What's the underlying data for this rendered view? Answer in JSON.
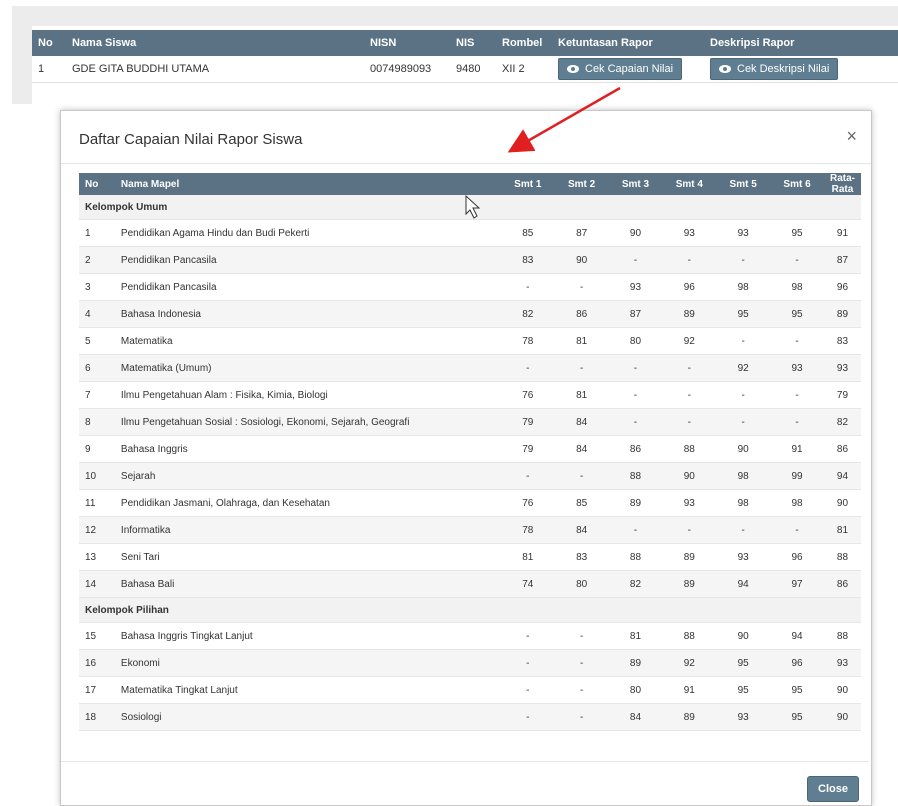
{
  "student_table": {
    "headers": [
      "No",
      "Nama Siswa",
      "NISN",
      "NIS",
      "Rombel",
      "Ketuntasan Rapor",
      "Deskripsi Rapor"
    ],
    "row": {
      "no": "1",
      "name": "GDE GITA BUDDHI UTAMA",
      "nisn": "0074989093",
      "nis": "9480",
      "rombel": "XII 2",
      "btn_capaian": "Cek Capaian Nilai",
      "btn_deskripsi": "Cek Deskripsi Nilai"
    }
  },
  "modal": {
    "title": "Daftar Capaian Nilai Rapor Siswa",
    "close_symbol": "×",
    "headers": {
      "no": "No",
      "mapel": "Nama Mapel",
      "smt1": "Smt 1",
      "smt2": "Smt 2",
      "smt3": "Smt 3",
      "smt4": "Smt 4",
      "smt5": "Smt 5",
      "smt6": "Smt 6",
      "avg": "Rata-Rata"
    },
    "groups": [
      {
        "label": "Kelompok Umum",
        "rows": [
          {
            "no": "1",
            "mapel": "Pendidikan Agama Hindu dan Budi Pekerti",
            "smt": [
              "85",
              "87",
              "90",
              "93",
              "93",
              "95"
            ],
            "avg": "91"
          },
          {
            "no": "2",
            "mapel": "Pendidikan Pancasila",
            "smt": [
              "83",
              "90",
              "-",
              "-",
              "-",
              "-"
            ],
            "avg": "87"
          },
          {
            "no": "3",
            "mapel": "Pendidikan Pancasila",
            "smt": [
              "-",
              "-",
              "93",
              "96",
              "98",
              "98"
            ],
            "avg": "96"
          },
          {
            "no": "4",
            "mapel": "Bahasa Indonesia",
            "smt": [
              "82",
              "86",
              "87",
              "89",
              "95",
              "95"
            ],
            "avg": "89"
          },
          {
            "no": "5",
            "mapel": "Matematika",
            "smt": [
              "78",
              "81",
              "80",
              "92",
              "-",
              "-"
            ],
            "avg": "83"
          },
          {
            "no": "6",
            "mapel": "Matematika (Umum)",
            "smt": [
              "-",
              "-",
              "-",
              "-",
              "92",
              "93"
            ],
            "avg": "93"
          },
          {
            "no": "7",
            "mapel": "Ilmu Pengetahuan Alam : Fisika, Kimia, Biologi",
            "smt": [
              "76",
              "81",
              "-",
              "-",
              "-",
              "-"
            ],
            "avg": "79"
          },
          {
            "no": "8",
            "mapel": "Ilmu Pengetahuan Sosial : Sosiologi, Ekonomi, Sejarah, Geografi",
            "smt": [
              "79",
              "84",
              "-",
              "-",
              "-",
              "-"
            ],
            "avg": "82"
          },
          {
            "no": "9",
            "mapel": "Bahasa Inggris",
            "smt": [
              "79",
              "84",
              "86",
              "88",
              "90",
              "91"
            ],
            "avg": "86"
          },
          {
            "no": "10",
            "mapel": "Sejarah",
            "smt": [
              "-",
              "-",
              "88",
              "90",
              "98",
              "99"
            ],
            "avg": "94"
          },
          {
            "no": "11",
            "mapel": "Pendidikan Jasmani, Olahraga, dan Kesehatan",
            "smt": [
              "76",
              "85",
              "89",
              "93",
              "98",
              "98"
            ],
            "avg": "90"
          },
          {
            "no": "12",
            "mapel": "Informatika",
            "smt": [
              "78",
              "84",
              "-",
              "-",
              "-",
              "-"
            ],
            "avg": "81"
          },
          {
            "no": "13",
            "mapel": "Seni Tari",
            "smt": [
              "81",
              "83",
              "88",
              "89",
              "93",
              "96"
            ],
            "avg": "88"
          },
          {
            "no": "14",
            "mapel": "Bahasa Bali",
            "smt": [
              "74",
              "80",
              "82",
              "89",
              "94",
              "97"
            ],
            "avg": "86"
          }
        ]
      },
      {
        "label": "Kelompok Pilihan",
        "rows": [
          {
            "no": "15",
            "mapel": "Bahasa Inggris Tingkat Lanjut",
            "smt": [
              "-",
              "-",
              "81",
              "88",
              "90",
              "94"
            ],
            "avg": "88"
          },
          {
            "no": "16",
            "mapel": "Ekonomi",
            "smt": [
              "-",
              "-",
              "89",
              "92",
              "95",
              "96"
            ],
            "avg": "93"
          },
          {
            "no": "17",
            "mapel": "Matematika Tingkat Lanjut",
            "smt": [
              "-",
              "-",
              "80",
              "91",
              "95",
              "95"
            ],
            "avg": "90"
          },
          {
            "no": "18",
            "mapel": "Sosiologi",
            "smt": [
              "-",
              "-",
              "84",
              "89",
              "93",
              "95"
            ],
            "avg": "90"
          }
        ]
      }
    ],
    "close_button": "Close"
  },
  "colors": {
    "header_bg": "#5a7284",
    "button_bg": "#5f7e92",
    "annotation_arrow": "#e02020"
  }
}
